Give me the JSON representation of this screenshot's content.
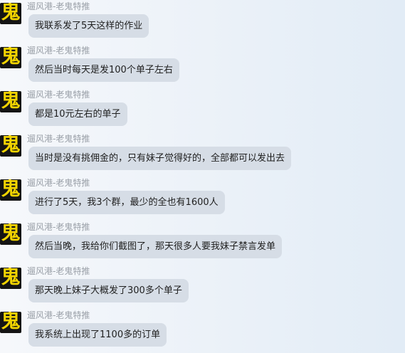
{
  "messages": [
    {
      "sender": "遛风港-老鬼特推",
      "avatar_glyph": "鬼",
      "text": "我联系发了5天这样的作业"
    },
    {
      "sender": "遛风港-老鬼特推",
      "avatar_glyph": "鬼",
      "text": "然后当时每天是发100个单子左右"
    },
    {
      "sender": "遛风港-老鬼特推",
      "avatar_glyph": "鬼",
      "text": "都是10元左右的单子"
    },
    {
      "sender": "遛风港-老鬼特推",
      "avatar_glyph": "鬼",
      "text": "当时是没有挑佣金的，只有妹子觉得好的，全部都可以发出去"
    },
    {
      "sender": "遛风港-老鬼特推",
      "avatar_glyph": "鬼",
      "text": "进行了5天，我3个群，最少的全也有1600人"
    },
    {
      "sender": "遛风港-老鬼特推",
      "avatar_glyph": "鬼",
      "text": "然后当晚，我给你们截图了，那天很多人要我妹子禁言发单"
    },
    {
      "sender": "遛风港-老鬼特推",
      "avatar_glyph": "鬼",
      "text": "那天晚上妹子大概发了300多个单子"
    },
    {
      "sender": "遛风港-老鬼特推",
      "avatar_glyph": "鬼",
      "text": "我系统上出现了1100多的订单"
    }
  ],
  "colors": {
    "bubble": "#d6dde6",
    "sender_text": "#9aa0a8",
    "message_text": "#1f1f1f",
    "avatar_bg": "#141414",
    "avatar_glyph": "#f2d400"
  }
}
